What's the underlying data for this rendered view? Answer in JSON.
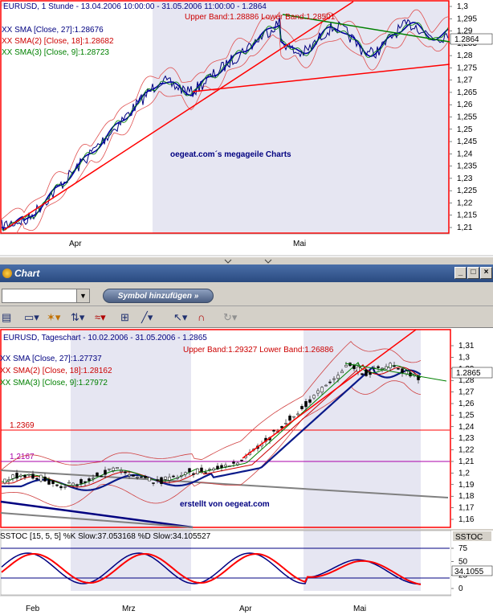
{
  "top_panel": {
    "header": "EURUSD, 1 Stunde - 13.04.2006 10:00:00 - 31.05.2006 11:00:00 - 1.2864",
    "band_text": "Upper Band:1.28886 Lower Band:1.28501",
    "legend": [
      {
        "text": "SMA [Close, 27]:1.28676",
        "color": "#000080"
      },
      {
        "text": "SMA(2) [Close, 18]:1.28682",
        "color": "#cc0000"
      },
      {
        "text": "SMA(3) [Close, 9]:1.28723",
        "color": "#008000"
      }
    ],
    "watermark": "oegeat.com´s megageile Charts",
    "last_price": "1.2864",
    "y_ticks": [
      "1,3",
      "1,295",
      "1,29",
      "1,285",
      "1,28",
      "1,275",
      "1,27",
      "1,265",
      "1,26",
      "1,255",
      "1,25",
      "1,245",
      "1,24",
      "1,235",
      "1,23",
      "1,225",
      "1,22",
      "1,215",
      "1,21"
    ],
    "x_labels": [
      "Apr",
      "Mai"
    ]
  },
  "window": {
    "title": "Chart",
    "buttons": [
      "_",
      "□",
      "×"
    ]
  },
  "toolbar": {
    "symbol_value": "",
    "add_symbol_label": "Symbol hinzufügen »"
  },
  "bottom_panel": {
    "header": "EURUSD, Tageschart - 10.02.2006 - 31.05.2006 - 1.2865",
    "band_text": "Upper Band:1.29327 Lower Band:1.26886",
    "legend": [
      {
        "text": "SMA [Close, 27]:1.27737",
        "color": "#000080"
      },
      {
        "text": "SMA(2) [Close, 18]:1.28162",
        "color": "#cc0000"
      },
      {
        "text": "SMA(3) [Close, 9]:1.27972",
        "color": "#008000"
      }
    ],
    "level_1": "1.2369",
    "level_2": "1.2167",
    "watermark": "erstellt von oegeat.com",
    "last_price": "1.2865",
    "y_ticks": [
      "1,31",
      "1,3",
      "1,29",
      "1,28",
      "1,27",
      "1,26",
      "1,25",
      "1,24",
      "1,23",
      "1,22",
      "1,21",
      "1,2",
      "1,19",
      "1,18",
      "1,17",
      "1,16"
    ],
    "x_labels": [
      "Feb",
      "Mrz",
      "Apr",
      "Mai"
    ]
  },
  "stoch_panel": {
    "header": "SSTOC [15, 5, 5] %K Slow:37.053168 %D Slow:34.105527",
    "side_label": "SSTOC",
    "last_value": "34.1055",
    "y_ticks": [
      "75",
      "50",
      "25",
      "0"
    ]
  },
  "colors": {
    "chart_bg": "#ffffff",
    "shade_bg": "#e6e6f2",
    "price": "#000080",
    "sma_red": "#cc0000",
    "sma_green": "#008000",
    "trend": "#ff0000",
    "frame": "#ff0000"
  }
}
